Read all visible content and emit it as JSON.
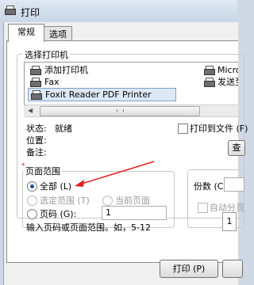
{
  "window": {
    "title": "打印"
  },
  "tabs": [
    {
      "label": "常规"
    },
    {
      "label": "选项"
    }
  ],
  "select_printer": {
    "label": "选择打印机",
    "printers": [
      {
        "name": "添加打印机",
        "icon": "add-printer-icon"
      },
      {
        "name": "Micro",
        "icon": "printer-icon"
      },
      {
        "name": "Fax",
        "icon": "fax-icon"
      },
      {
        "name": "发送至",
        "icon": "send-printer-icon"
      },
      {
        "name": "Foxit Reader PDF Printer",
        "icon": "printer-icon",
        "selected": true
      }
    ]
  },
  "status": {
    "status_label": "状态:",
    "status_value": "就绪",
    "location_label": "位置:",
    "comment_label": "备注:"
  },
  "print_to_file": {
    "label": "打印到文件 (F)"
  },
  "find_button": {
    "label": "查"
  },
  "page_range": {
    "label": "页面范围",
    "all": "全部 (L)",
    "selection": "选定范围 (T)",
    "current_page": "当前页面",
    "pages": "页码 (G):",
    "pages_value": "1",
    "hint": "输入页码或页面范围。如，5-12"
  },
  "copies": {
    "label": "份数 (C):",
    "collate": "自动分页",
    "first_copy": "1"
  },
  "footer": {
    "print_button": "打印 (P)"
  },
  "annotation": {
    "arrow_color": "#e02020"
  }
}
